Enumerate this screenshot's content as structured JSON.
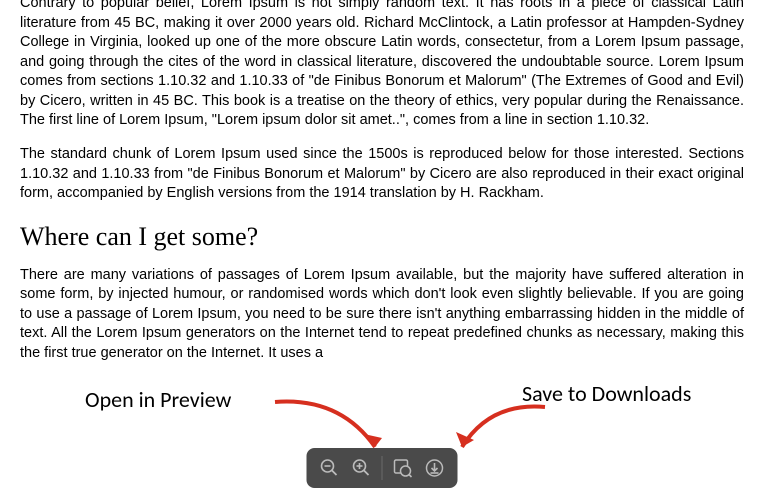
{
  "content": {
    "para1": "Contrary to popular belief, Lorem Ipsum is not simply random text. It has roots in a piece of classical Latin literature from 45 BC, making it over 2000 years old. Richard McClintock, a Latin professor at Hampden-Sydney College in Virginia, looked up one of the more obscure Latin words, consectetur, from a Lorem Ipsum passage, and going through the cites of the word in classical literature, discovered the undoubtable source. Lorem Ipsum comes from sections 1.10.32 and 1.10.33 of \"de Finibus Bonorum et Malorum\" (The Extremes of Good and Evil) by Cicero, written in 45 BC. This book is a treatise on the theory of ethics, very popular during the Renaissance. The first line of Lorem Ipsum, \"Lorem ipsum dolor sit amet..\", comes from a line in section 1.10.32.",
    "para2": "The standard chunk of Lorem Ipsum used since the 1500s is reproduced below for those interested. Sections 1.10.32 and 1.10.33 from \"de Finibus Bonorum et Malorum\" by Cicero are also reproduced in their exact original form, accompanied by English versions from the 1914 translation by H. Rackham.",
    "heading": "Where can I get some?",
    "para3": "There are many variations of passages of Lorem Ipsum available, but the majority have suffered alteration in some form, by injected humour, or randomised words which don't look even slightly believable. If you are going to use a passage of Lorem Ipsum, you need to be sure there isn't anything embarrassing hidden in the middle of text. All the Lorem Ipsum generators on the Internet tend to repeat predefined chunks as necessary, making this the first true generator on the Internet. It uses a"
  },
  "annotations": {
    "left_label": "Open in Preview",
    "right_label": "Save to Downloads"
  },
  "toolbar": {
    "zoom_out": "Zoom Out",
    "zoom_in": "Zoom In",
    "open_preview": "Open in Preview",
    "save_downloads": "Save to Downloads"
  }
}
